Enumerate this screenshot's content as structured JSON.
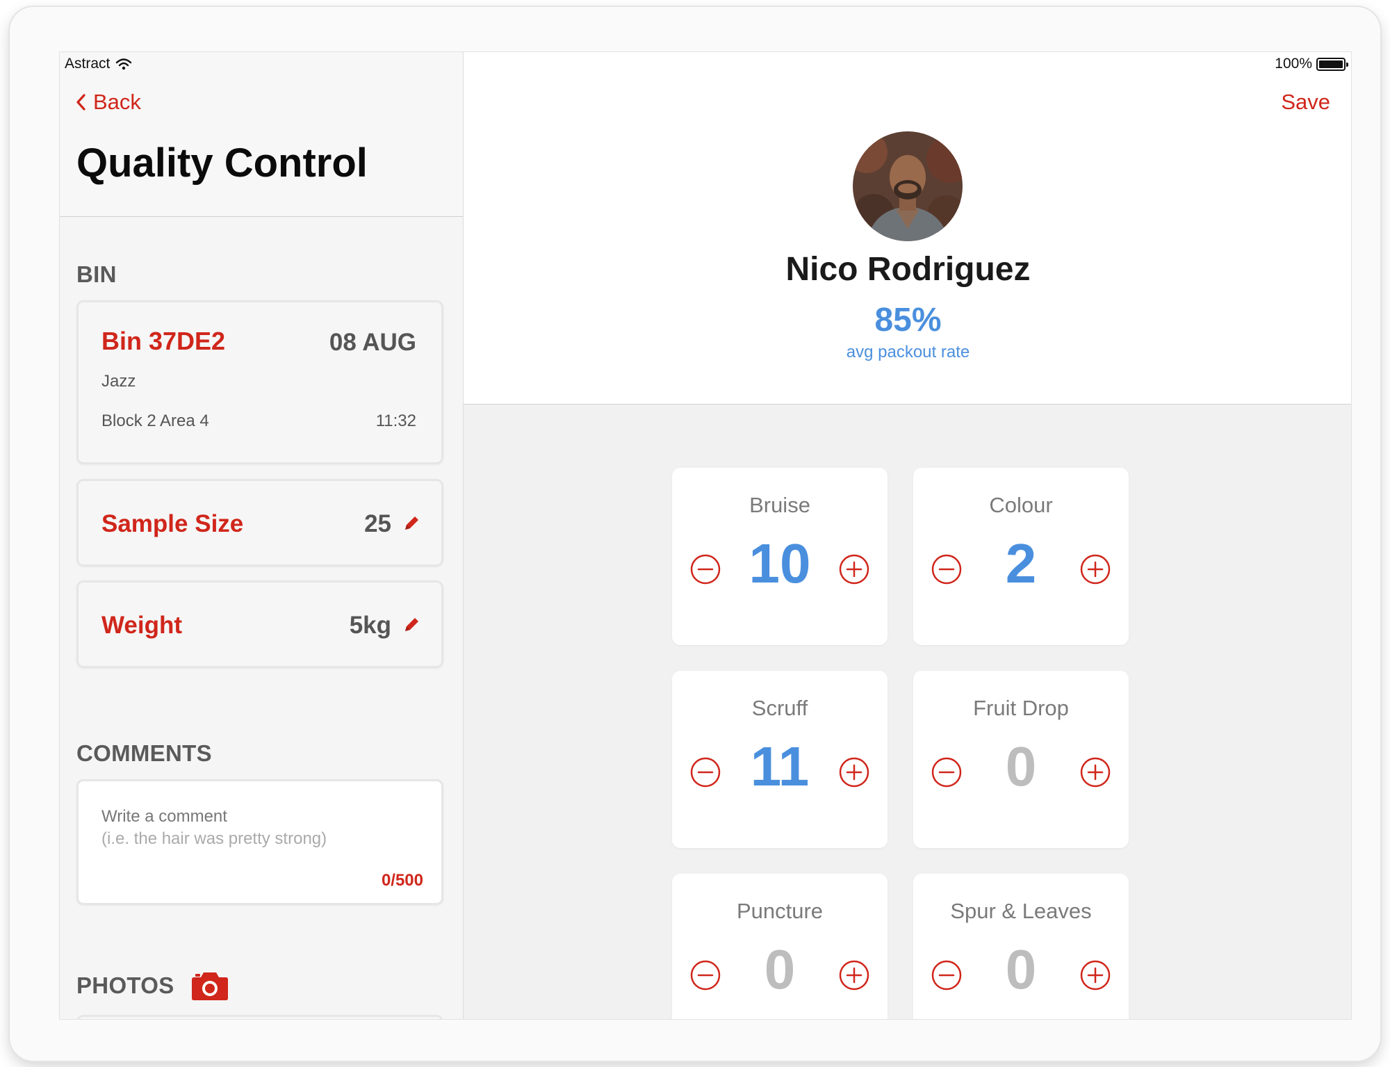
{
  "status_bar": {
    "carrier": "Astract",
    "battery": "100%"
  },
  "nav": {
    "back_label": "Back",
    "save_label": "Save"
  },
  "page": {
    "title": "Quality Control"
  },
  "bin_section": {
    "label": "BIN",
    "bin_name": "Bin 37DE2",
    "date": "08 AUG",
    "variety": "Jazz",
    "location": "Block 2 Area 4",
    "time": "11:32"
  },
  "sample_size": {
    "label": "Sample Size",
    "value": "25"
  },
  "weight": {
    "label": "Weight",
    "value": "5kg"
  },
  "comments": {
    "label": "COMMENTS",
    "placeholder_line1": "Write a comment",
    "placeholder_line2": "(i.e. the hair was pretty strong)",
    "count": "0/500"
  },
  "photos": {
    "label": "PHOTOS"
  },
  "picker": {
    "name": "Nico Rodriguez",
    "rate": "85%",
    "rate_label": "avg packout rate"
  },
  "defects": [
    {
      "name": "Bruise",
      "count": "10"
    },
    {
      "name": "Colour",
      "count": "2"
    },
    {
      "name": "Scruff",
      "count": "11"
    },
    {
      "name": "Fruit Drop",
      "count": "0"
    },
    {
      "name": "Puncture",
      "count": "0"
    },
    {
      "name": "Spur & Leaves",
      "count": "0"
    }
  ],
  "colors": {
    "accent_red": "#d0261b",
    "accent_blue": "#4a8fde",
    "muted_gray": "#bdbdbd"
  },
  "icons": {
    "back": "chevron-left-icon",
    "edit": "pencil-icon",
    "camera": "camera-icon",
    "minus": "minus-circle-icon",
    "plus": "plus-circle-icon",
    "wifi": "wifi-icon",
    "battery": "battery-icon"
  }
}
